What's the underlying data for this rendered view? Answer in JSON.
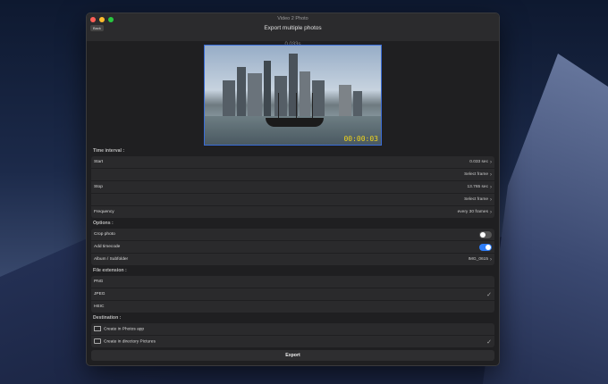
{
  "window": {
    "title": "Video 2 Photo",
    "back_label": "Back",
    "subtitle": "Export multiple photos",
    "timecode": "0.033s"
  },
  "preview": {
    "overlay_timecode": "00:00:03"
  },
  "time_interval": {
    "heading": "Time interval :",
    "start_label": "Start",
    "start_value": "0.033 sec",
    "select_frame_1": "Select frame",
    "stop_label": "Stop",
    "stop_value": "13.765 sec",
    "select_frame_2": "Select frame",
    "frequency_label": "Frequency",
    "frequency_value": "every 30 frames"
  },
  "options": {
    "heading": "Options :",
    "crop_label": "Crop photo",
    "crop_on": false,
    "timecode_label": "Add timecode",
    "timecode_on": true,
    "album_label": "Album / Subfolder",
    "album_value": "IMG_0615"
  },
  "file_extension": {
    "heading": "File extension :",
    "items": [
      "PNG",
      "JPEG",
      "HEIC"
    ],
    "selected": "JPEG"
  },
  "destination": {
    "heading": "Destination :",
    "photos_app": "Create in Photos app",
    "directory": "Create in directory Pictures"
  },
  "export_label": "Export",
  "colors": {
    "accent": "#2d7cf6",
    "timecode": "#f2d61a"
  }
}
